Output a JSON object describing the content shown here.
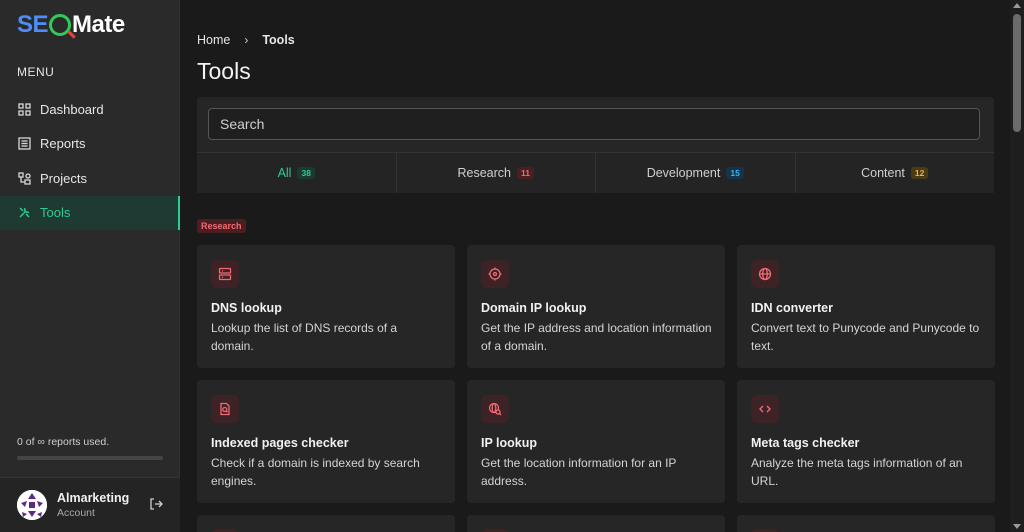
{
  "logo": {
    "part1": "SE",
    "part2": "Mate"
  },
  "sidebar": {
    "menu_title": "MENU",
    "items": [
      {
        "label": "Dashboard",
        "icon": "grid-icon"
      },
      {
        "label": "Reports",
        "icon": "list-icon"
      },
      {
        "label": "Projects",
        "icon": "nodes-icon"
      },
      {
        "label": "Tools",
        "icon": "tools-icon",
        "active": true
      }
    ],
    "usage_text": "0 of ∞ reports used.",
    "usage_fraction": 0,
    "account": {
      "name": "Almarketing",
      "role": "Account"
    }
  },
  "breadcrumb": {
    "home": "Home",
    "sep": "›",
    "current": "Tools"
  },
  "page_title": "Tools",
  "search": {
    "placeholder": "Search",
    "value": ""
  },
  "tabs": [
    {
      "label": "All",
      "count": "38",
      "color": "#2ecc8f",
      "bg": "#1c3a30",
      "active": true
    },
    {
      "label": "Research",
      "count": "11",
      "color": "#f26a74",
      "bg": "#4a1f22"
    },
    {
      "label": "Development",
      "count": "15",
      "color": "#3fb3e8",
      "bg": "#16334a"
    },
    {
      "label": "Content",
      "count": "12",
      "color": "#e8b43f",
      "bg": "#4a3a16"
    }
  ],
  "section": {
    "label": "Research"
  },
  "cards": [
    {
      "title": "DNS lookup",
      "desc": "Lookup the list of DNS records of a domain.",
      "icon": "server-icon"
    },
    {
      "title": "Domain IP lookup",
      "desc": "Get the IP address and location information of a domain.",
      "icon": "crosshair-icon"
    },
    {
      "title": "IDN converter",
      "desc": "Convert text to Punycode and Punycode to text.",
      "icon": "globe-icon"
    },
    {
      "title": "Indexed pages checker",
      "desc": "Check if a domain is indexed by search engines.",
      "icon": "file-search-icon"
    },
    {
      "title": "IP lookup",
      "desc": "Get the location information for an IP address.",
      "icon": "globe-search-icon"
    },
    {
      "title": "Meta tags checker",
      "desc": "Analyze the meta tags information of an URL.",
      "icon": "code-icon"
    }
  ],
  "colors": {
    "accent": "#2ecc8f",
    "research": "#f26a74"
  }
}
